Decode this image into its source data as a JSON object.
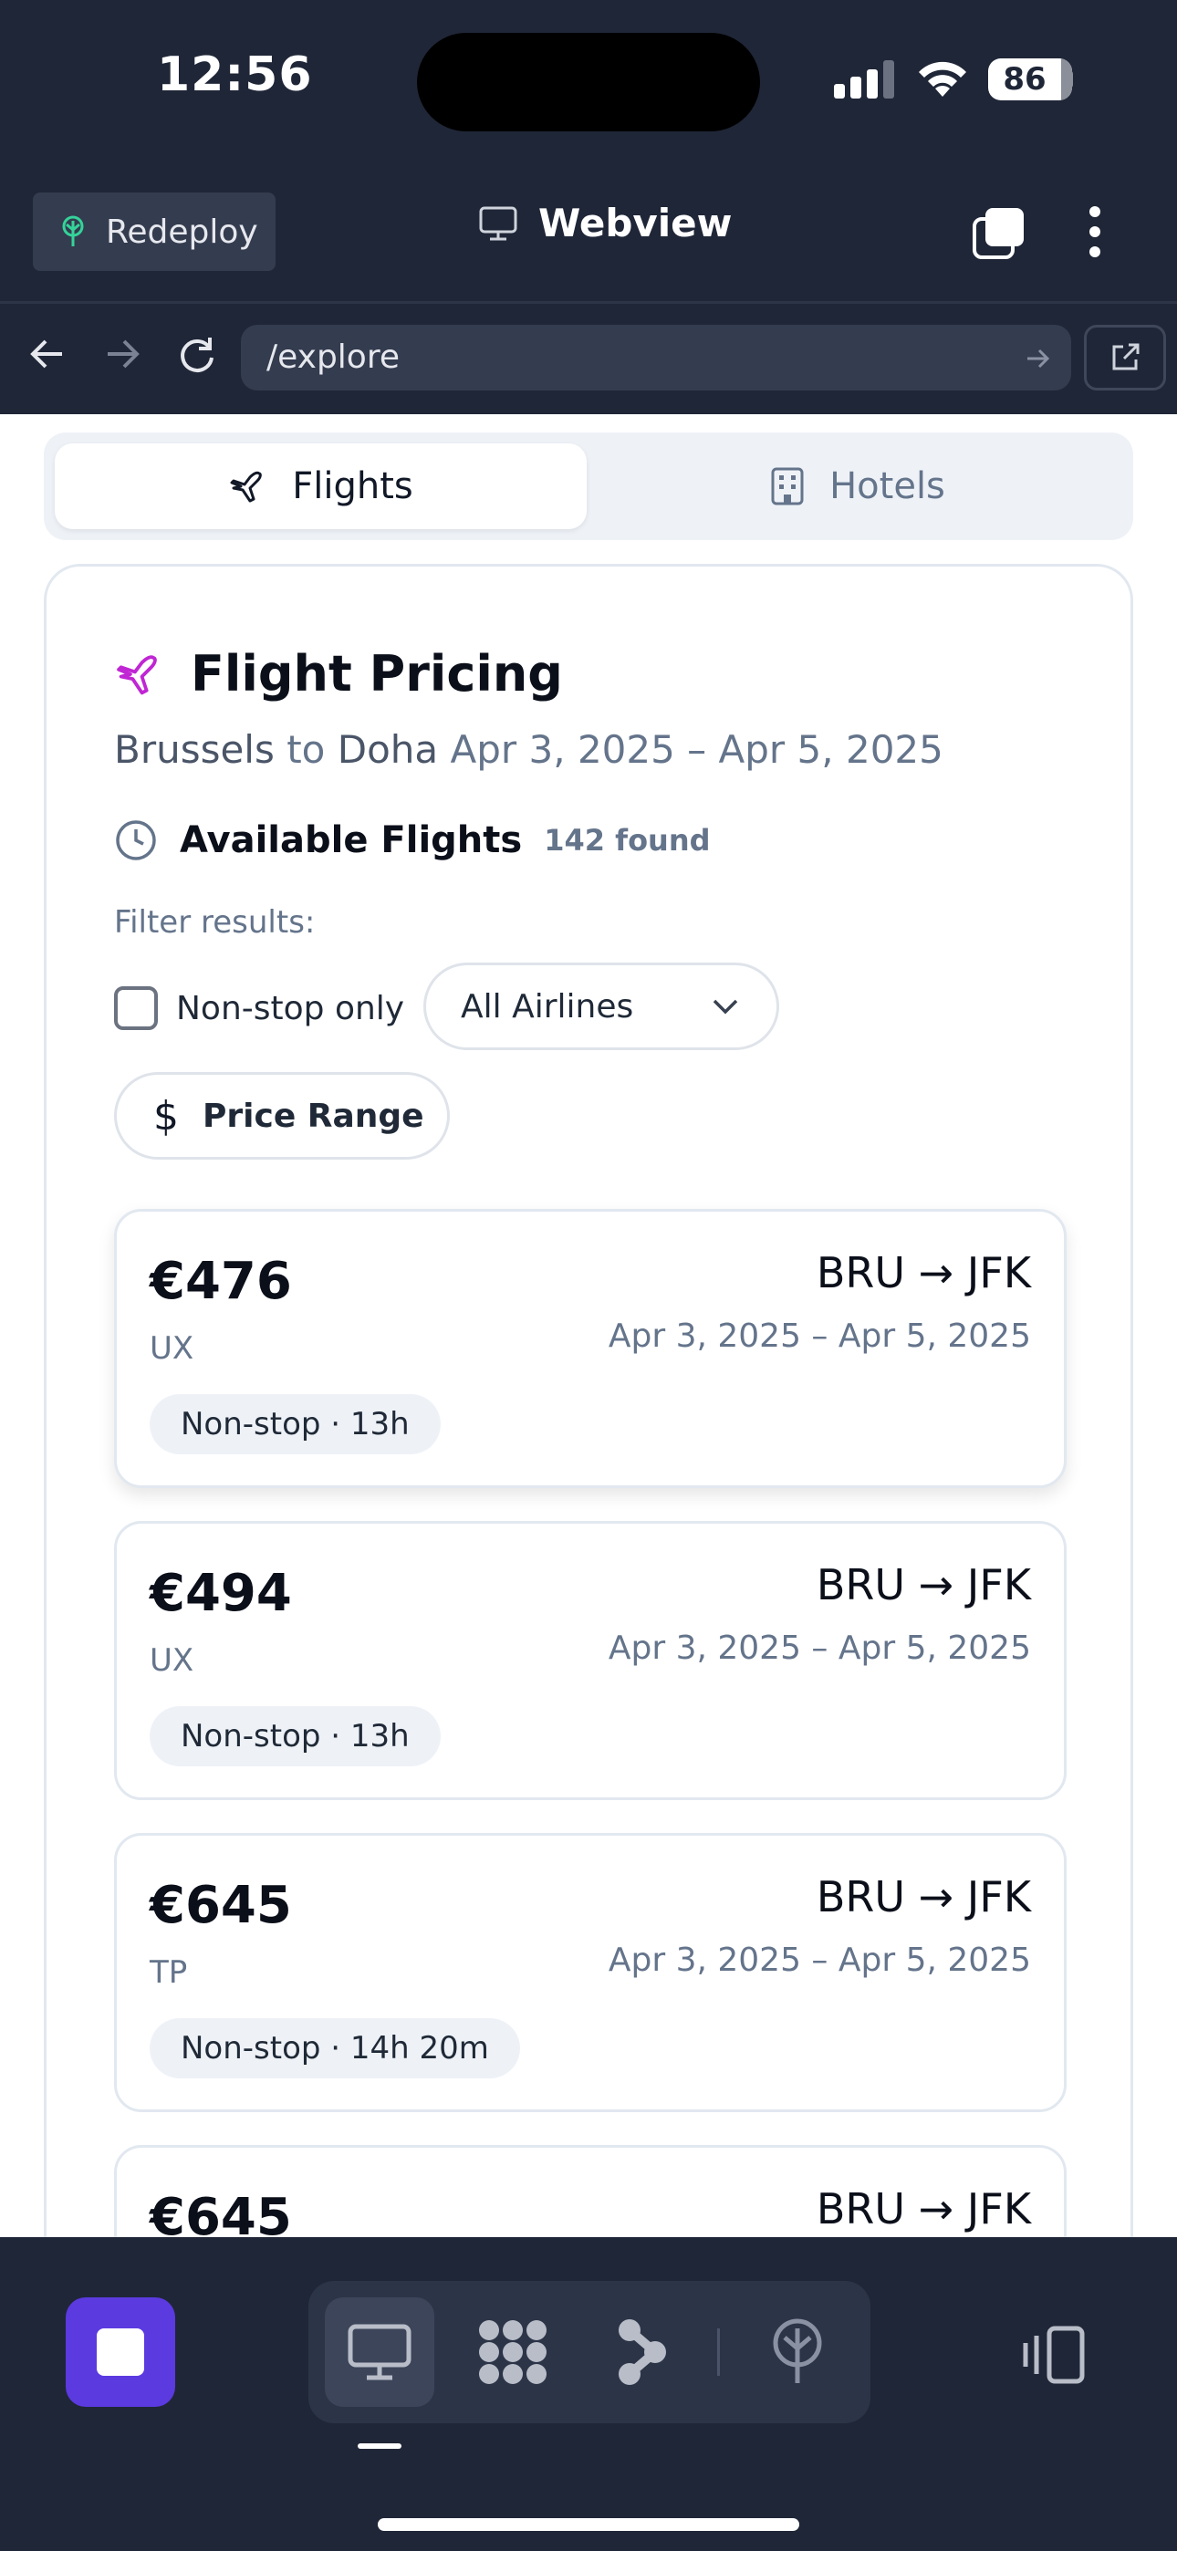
{
  "status_bar": {
    "time": "12:56",
    "battery": "86"
  },
  "toolbar": {
    "redeploy_label": "Redeploy",
    "title": "Webview"
  },
  "urlbar": {
    "path": "/explore"
  },
  "tabs": {
    "flights": "Flights",
    "hotels": "Hotels"
  },
  "pricing": {
    "title": "Flight Pricing",
    "origin": "Brussels",
    "connector": "to",
    "destination": "Doha",
    "date_range": "Apr 3, 2025 – Apr 5, 2025",
    "available_title": "Available Flights",
    "found_count": "142 found",
    "filter_label": "Filter results:",
    "nonstop_label": "Non-stop only",
    "airlines_select": "All Airlines",
    "price_range_label": "Price Range"
  },
  "flights": [
    {
      "price": "€476",
      "airline": "UX",
      "badge": "Non-stop · 13h",
      "route": "BRU → JFK",
      "dates": "Apr 3, 2025 – Apr 5, 2025"
    },
    {
      "price": "€494",
      "airline": "UX",
      "badge": "Non-stop · 13h",
      "route": "BRU → JFK",
      "dates": "Apr 3, 2025 – Apr 5, 2025"
    },
    {
      "price": "€645",
      "airline": "TP",
      "badge": "Non-stop · 14h 20m",
      "route": "BRU → JFK",
      "dates": "Apr 3, 2025 – Apr 5, 2025"
    },
    {
      "price": "€645",
      "route": "BRU → JFK"
    }
  ],
  "colors": {
    "accent": "#5b3ae0",
    "plane_icon": "#c026d3",
    "chrome": "#1f2637"
  }
}
